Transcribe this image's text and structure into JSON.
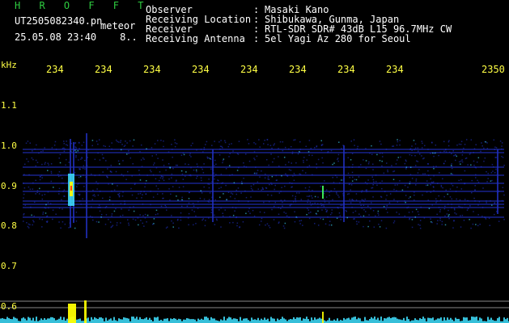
{
  "header": {
    "app_title": "H R O F F T",
    "filename": "UT2505082340.pn",
    "type_label": "meteor",
    "datetime": "25.05.08 23:40",
    "datetime_extra": "8.."
  },
  "info": {
    "rows": [
      {
        "label": "Observer",
        "value": "Masaki Kano"
      },
      {
        "label": "Receiving Location",
        "value": "Shibukawa, Gunma, Japan"
      },
      {
        "label": "Receiver",
        "value": "RTL-SDR SDR# 43dB L15 96.7MHz CW"
      },
      {
        "label": "Receiving Antenna",
        "value": "5el Yagi Az 280 for Seoul"
      }
    ],
    "separator": ":"
  },
  "axes": {
    "y_unit": "kHz",
    "x_ticks": [
      "234",
      "234",
      "234",
      "234",
      "234",
      "234",
      "234",
      "234",
      "2350"
    ],
    "y_ticks": [
      "1.1",
      "1.0",
      "0.9",
      "0.8",
      "0.7",
      "0.6"
    ]
  },
  "colors": {
    "background": "#000000",
    "title_green": "#2ecc40",
    "axis_yellow": "#ffff44",
    "trail_blue": "#2030c0",
    "signal_cyan": "#40e0ff",
    "meteor_yellow": "#ffff00",
    "meteor_red": "#ff3020"
  }
}
